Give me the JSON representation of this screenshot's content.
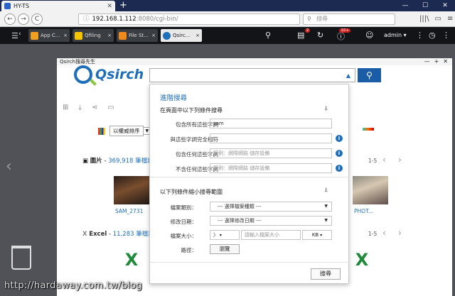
{
  "browser": {
    "tab_title": "HY-TS",
    "tab_close": "✕",
    "new_tab": "+",
    "window_controls": [
      "—",
      "☐",
      "✕"
    ],
    "back": "←",
    "forward": "→",
    "reload": "C",
    "url_host": "192.168.1.112",
    "url_path": ":8080/cgi-bin/",
    "info_icon": "ⓘ",
    "search_placeholder": "搜尋",
    "nav_icons": [
      "|||\\",
      "▭",
      "≡"
    ]
  },
  "qts": {
    "tabs": [
      {
        "label": "App C...",
        "color": "#f0a020"
      },
      {
        "label": "Qfiling",
        "color": "#f5c400"
      },
      {
        "label": "File St...",
        "color": "#f08a1c"
      },
      {
        "label": "Qsirc...",
        "color": "#1e6fb8"
      }
    ],
    "tab_close": "×",
    "hamburger": "☰",
    "task_badge": "2",
    "alert_badge": "10+",
    "user": "admin ▾"
  },
  "qsirch": {
    "window_title": "Qsirch搜尋先生",
    "window_controls": [
      "—",
      "+",
      "✕"
    ],
    "logo_text": "Qsirch",
    "search_icon": "⚲",
    "caret": "▲",
    "sort_label": "以權威排序",
    "sort_caret": "▼",
    "categories": [
      {
        "icon": "📷",
        "name": "圖片",
        "count": "369,918 筆檔案",
        "pager": "1-5"
      },
      {
        "icon": "X",
        "name": "Excel",
        "count": "11,283 筆檔案",
        "pager": "1-5"
      }
    ],
    "file_names": [
      "SAM_2731",
      "PHOT..."
    ],
    "chevrons": {
      "left": "‹",
      "right": "›"
    }
  },
  "advanced": {
    "title": "進階搜尋",
    "section1": "在頁面中以下列條件搜尋",
    "erase_icon": "⍋",
    "fields": [
      {
        "label": "包含所有這些字詞",
        "value": "sam",
        "placeholder": "",
        "info": false
      },
      {
        "label": "與這些字詞完全相符",
        "value": "",
        "placeholder": "",
        "info": true
      },
      {
        "label": "包含任何這些字詞",
        "value": "",
        "placeholder": "範例：網際網路 儲存設備",
        "info": true
      },
      {
        "label": "不含任何這些字詞",
        "value": "",
        "placeholder": "範例：網際網路 儲存設備",
        "info": true
      }
    ],
    "section2": "以下列條件縮小搜尋範圍",
    "file_type_label": "檔案類別：",
    "file_type_value": "--- 選擇檔案種類 ---",
    "modified_label": "修改日期：",
    "modified_value": "--- 選擇修改日期 ---",
    "size_label": "檔案大小：",
    "size_op": "〉",
    "size_placeholder": "請輸入檔案大小",
    "size_unit": "KB",
    "path_label": "路徑：",
    "browse": "瀏覽",
    "submit": "搜尋",
    "info_glyph": "i"
  },
  "watermark": "http://hardaway.com.tw/blog"
}
